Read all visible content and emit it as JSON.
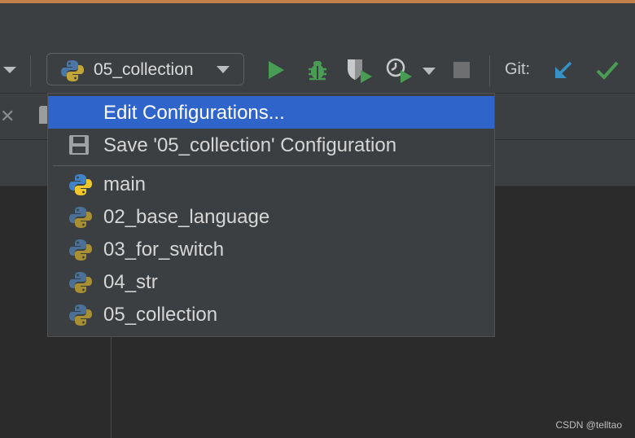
{
  "toolbar": {
    "run_config": {
      "label": "05_collection"
    },
    "git_label": "Git:"
  },
  "dropdown": {
    "items": [
      {
        "label": "Edit Configurations...",
        "icon": "none",
        "selected": true
      },
      {
        "label": "Save '05_collection' Configuration",
        "icon": "save-icon"
      },
      {
        "label": "main",
        "icon": "python-icon"
      },
      {
        "label": "02_base_language",
        "icon": "python-icon-dim"
      },
      {
        "label": "03_for_switch",
        "icon": "python-icon-dim"
      },
      {
        "label": "04_str",
        "icon": "python-icon-dim"
      },
      {
        "label": "05_collection",
        "icon": "python-icon-dim"
      }
    ]
  },
  "watermark": "CSDN @telltao",
  "colors": {
    "accent_blue": "#2f65ca",
    "run_green": "#499c54",
    "git_blue": "#3592c4"
  }
}
